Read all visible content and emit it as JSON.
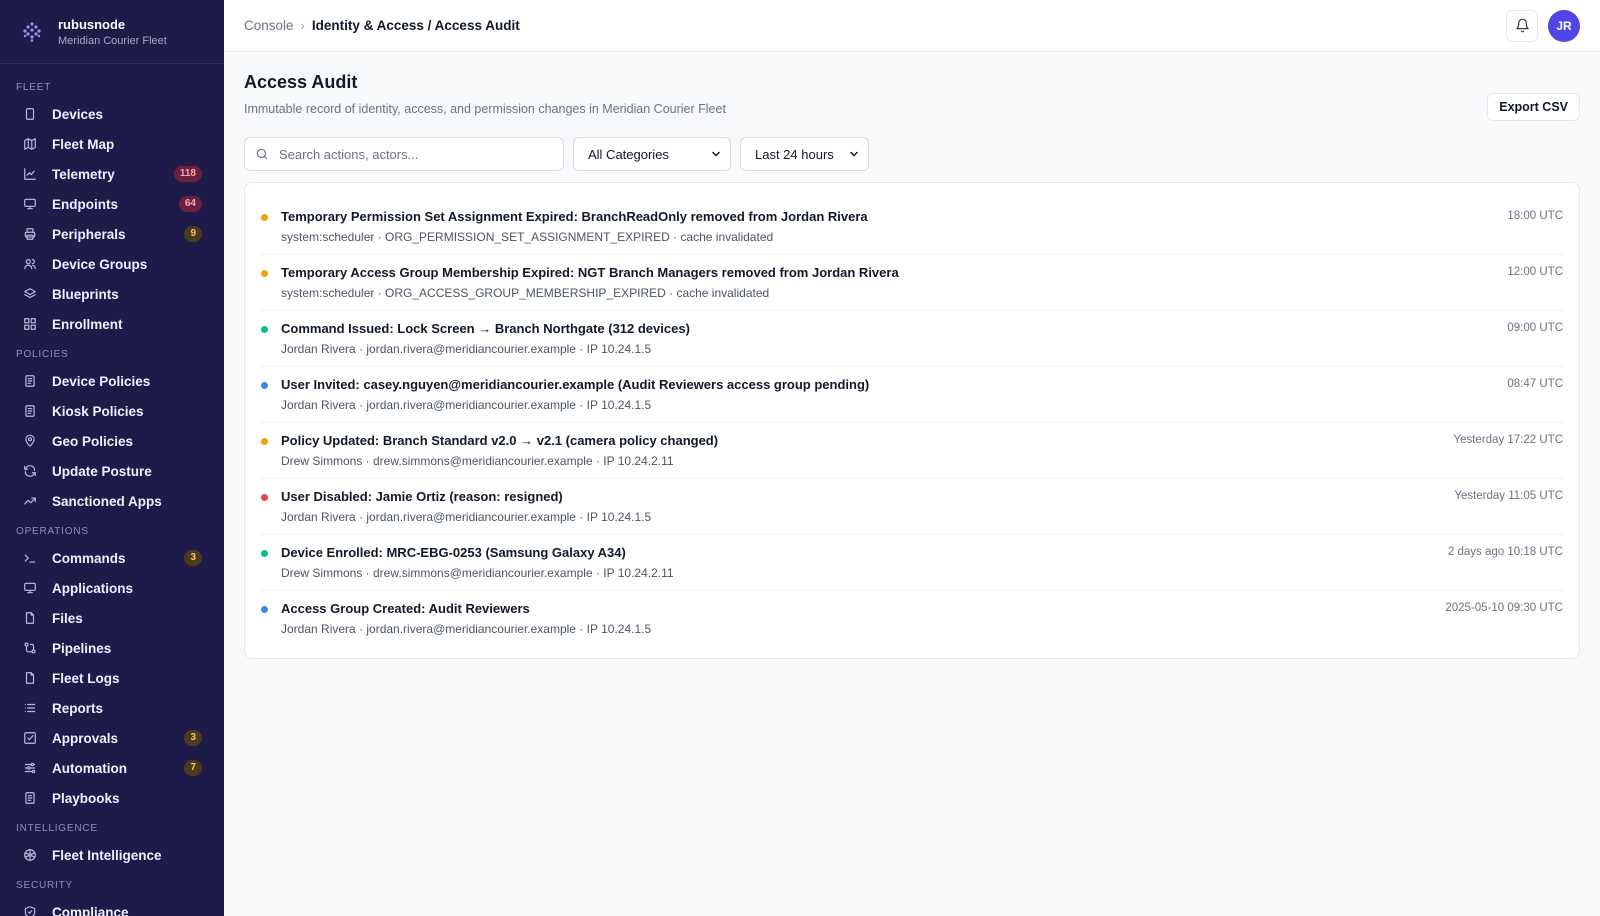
{
  "brand": {
    "name": "rubusnode",
    "subtitle": "Meridian Courier Fleet"
  },
  "sidebar": {
    "sections": [
      {
        "title": "Fleet",
        "items": [
          {
            "label": "Devices",
            "icon": "device-icon",
            "badge": ""
          },
          {
            "label": "Fleet Map",
            "icon": "map-icon",
            "badge": ""
          },
          {
            "label": "Telemetry",
            "icon": "chart-icon",
            "badge": "118"
          },
          {
            "label": "Endpoints",
            "icon": "monitor-icon",
            "badge": "64"
          },
          {
            "label": "Peripherals",
            "icon": "printer-icon",
            "badge": "9"
          },
          {
            "label": "Device Groups",
            "icon": "users-icon",
            "badge": ""
          },
          {
            "label": "Blueprints",
            "icon": "layers-icon",
            "badge": ""
          },
          {
            "label": "Enrollment",
            "icon": "grid-icon",
            "badge": ""
          }
        ]
      },
      {
        "title": "Policies",
        "items": [
          {
            "label": "Device Policies",
            "icon": "document-icon",
            "badge": ""
          },
          {
            "label": "Kiosk Policies",
            "icon": "document-icon",
            "badge": ""
          },
          {
            "label": "Geo Policies",
            "icon": "pin-icon",
            "badge": ""
          },
          {
            "label": "Update Posture",
            "icon": "refresh-icon",
            "badge": ""
          },
          {
            "label": "Sanctioned Apps",
            "icon": "trend-icon",
            "badge": ""
          }
        ]
      },
      {
        "title": "Operations",
        "items": [
          {
            "label": "Commands",
            "icon": "terminal-icon",
            "badge": "3"
          },
          {
            "label": "Applications",
            "icon": "monitor-icon",
            "badge": ""
          },
          {
            "label": "Files",
            "icon": "file-icon",
            "badge": ""
          },
          {
            "label": "Pipelines",
            "icon": "pipeline-icon",
            "badge": ""
          },
          {
            "label": "Fleet Logs",
            "icon": "file-icon",
            "badge": ""
          },
          {
            "label": "Reports",
            "icon": "list-icon",
            "badge": ""
          },
          {
            "label": "Approvals",
            "icon": "check-square-icon",
            "badge": "3"
          },
          {
            "label": "Automation",
            "icon": "sliders-icon",
            "badge": "7"
          },
          {
            "label": "Playbooks",
            "icon": "document-icon",
            "badge": ""
          }
        ]
      },
      {
        "title": "Intelligence",
        "items": [
          {
            "label": "Fleet Intelligence",
            "icon": "atom-icon",
            "badge": ""
          }
        ]
      },
      {
        "title": "Security",
        "items": [
          {
            "label": "Compliance",
            "icon": "shield-icon",
            "badge": ""
          }
        ]
      }
    ],
    "badge_colors": {
      "118": "red",
      "64": "red",
      "9": "amber",
      "3": "amber",
      "7": "amber"
    }
  },
  "topbar": {
    "breadcrumb_root": "Console",
    "breadcrumb_current": "Identity & Access / Access Audit",
    "avatar_initials": "JR"
  },
  "page": {
    "title": "Access Audit",
    "subtitle": "Immutable record of identity, access, and permission changes in Meridian Courier Fleet",
    "export_label": "Export CSV"
  },
  "filters": {
    "search_placeholder": "Search actions, actors...",
    "category_value": "All Categories",
    "time_value": "Last 24 hours"
  },
  "colors": {
    "amber": "#f59e0b",
    "green": "#10b981",
    "blue": "#3b82f6",
    "red": "#ef4444",
    "sidebar": "#1e1b4b",
    "avatar": "#4f46e5"
  },
  "events": [
    {
      "status": "amber",
      "title": "Temporary Permission Set Assignment Expired: BranchReadOnly removed from Jordan Rivera",
      "meta": "system:scheduler · ORG_PERMISSION_SET_ASSIGNMENT_EXPIRED · cache invalidated",
      "time": "18:00 UTC"
    },
    {
      "status": "amber",
      "title": "Temporary Access Group Membership Expired: NGT Branch Managers removed from Jordan Rivera",
      "meta": "system:scheduler · ORG_ACCESS_GROUP_MEMBERSHIP_EXPIRED · cache invalidated",
      "time": "12:00 UTC"
    },
    {
      "status": "green",
      "title": "Command Issued: Lock Screen → Branch Northgate (312 devices)",
      "meta": "Jordan Rivera · jordan.rivera@meridiancourier.example · IP 10.24.1.5",
      "time": "09:00 UTC"
    },
    {
      "status": "blue",
      "title": "User Invited: casey.nguyen@meridiancourier.example (Audit Reviewers access group pending)",
      "meta": "Jordan Rivera · jordan.rivera@meridiancourier.example · IP 10.24.1.5",
      "time": "08:47 UTC"
    },
    {
      "status": "amber",
      "title": "Policy Updated: Branch Standard v2.0 → v2.1 (camera policy changed)",
      "meta": "Drew Simmons · drew.simmons@meridiancourier.example · IP 10.24.2.11",
      "time": "Yesterday 17:22 UTC"
    },
    {
      "status": "red",
      "title": "User Disabled: Jamie Ortiz (reason: resigned)",
      "meta": "Jordan Rivera · jordan.rivera@meridiancourier.example · IP 10.24.1.5",
      "time": "Yesterday 11:05 UTC"
    },
    {
      "status": "green",
      "title": "Device Enrolled: MRC-EBG-0253 (Samsung Galaxy A34)",
      "meta": "Drew Simmons · drew.simmons@meridiancourier.example · IP 10.24.2.11",
      "time": "2 days ago 10:18 UTC"
    },
    {
      "status": "blue",
      "title": "Access Group Created: Audit Reviewers",
      "meta": "Jordan Rivera · jordan.rivera@meridiancourier.example · IP 10.24.1.5",
      "time": "2025-05-10 09:30 UTC"
    }
  ]
}
